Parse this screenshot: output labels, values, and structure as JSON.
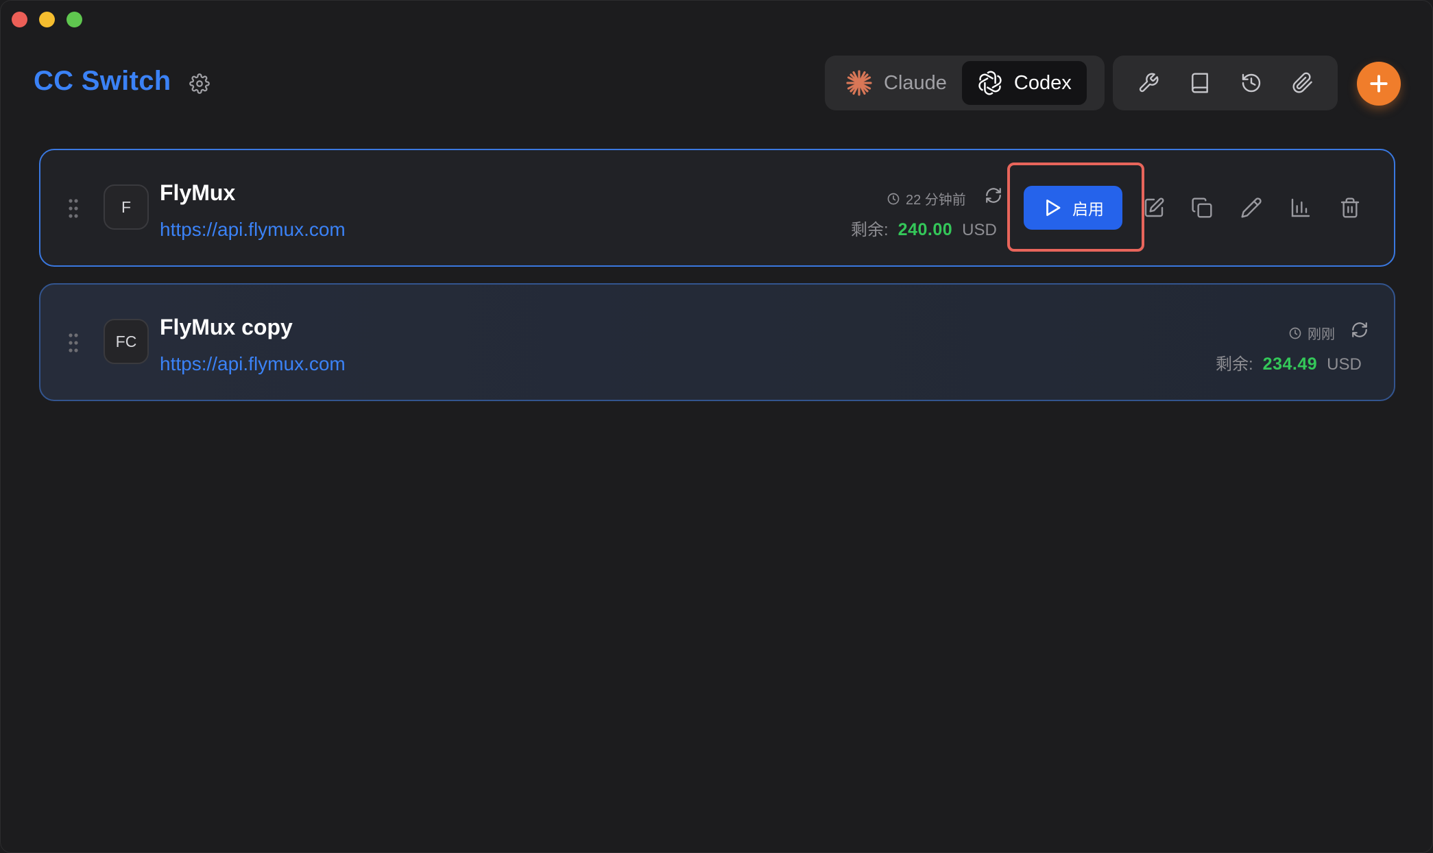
{
  "app": {
    "title": "CC Switch"
  },
  "tabs": [
    {
      "label": "Claude",
      "icon": "claude-sparkle-icon",
      "active": false
    },
    {
      "label": "Codex",
      "icon": "openai-icon",
      "active": true
    }
  ],
  "toolbar": {
    "icons": [
      "wrench-icon",
      "book-icon",
      "history-icon",
      "paperclip-icon"
    ],
    "add_icon": "plus-icon"
  },
  "providers": [
    {
      "initials": "F",
      "name": "FlyMux",
      "url": "https://api.flymux.com",
      "updated": "22 分钟前",
      "balance_label": "剩余:",
      "balance_amount": "240.00",
      "currency": "USD",
      "enable_label": "启用"
    },
    {
      "initials": "FC",
      "name": "FlyMux copy",
      "url": "https://api.flymux.com",
      "updated": "刚刚",
      "balance_label": "剩余:",
      "balance_amount": "234.49",
      "currency": "USD"
    }
  ],
  "colors": {
    "accent": "#3b82f6",
    "enable_button": "#2563eb",
    "add_button": "#f07d2b",
    "balance_green": "#34c759",
    "highlight": "#e8655b"
  }
}
